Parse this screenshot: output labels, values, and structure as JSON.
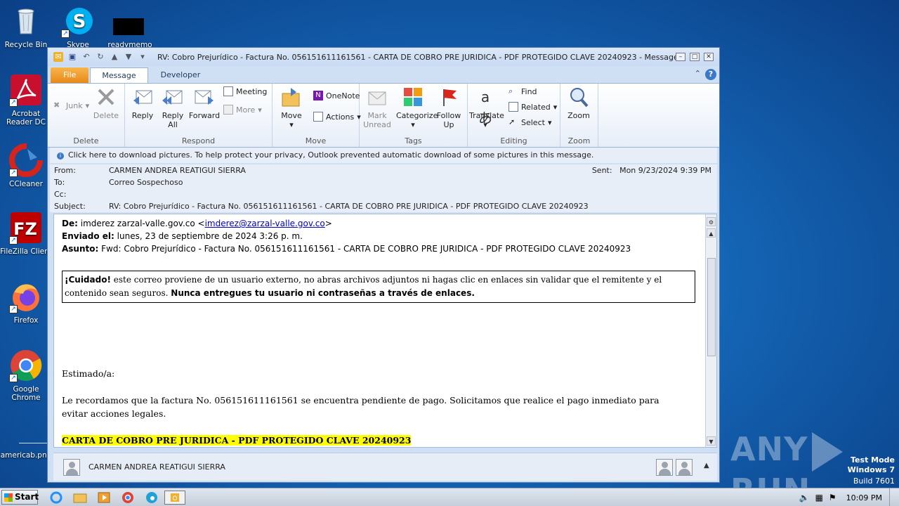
{
  "desktop": {
    "icons": [
      {
        "label": "Recycle Bin"
      },
      {
        "label": "Skype"
      },
      {
        "label": "readymemo"
      },
      {
        "label": "Acrobat Reader DC"
      },
      {
        "label": "CCleaner"
      },
      {
        "label": "FileZilla Client"
      },
      {
        "label": "Firefox"
      },
      {
        "label": "Google Chrome"
      },
      {
        "label": "americab.png"
      }
    ],
    "watermark": {
      "brand": "ANY RUN",
      "mode": "Test Mode",
      "os": "Windows 7",
      "build": "Build 7601"
    }
  },
  "window": {
    "title": "RV: Cobro Prejurídico - Factura No. 056151611161561 - CARTA DE COBRO PRE JURIDICA - PDF PROTEGIDO CLAVE 20240923  -  Message (HTM...",
    "tabs": [
      "File",
      "Message",
      "Developer"
    ],
    "ribbon": {
      "delete": {
        "label": "Delete",
        "junk": "Junk",
        "delete_btn": "Delete"
      },
      "respond": {
        "label": "Respond",
        "reply": "Reply",
        "reply_all": "Reply All",
        "forward": "Forward",
        "meeting": "Meeting",
        "more": "More"
      },
      "move": {
        "label": "Move",
        "move_btn": "Move",
        "onenote": "OneNote",
        "actions": "Actions"
      },
      "tags": {
        "label": "Tags",
        "mark_unread": "Mark Unread",
        "categorize": "Categorize",
        "follow_up": "Follow Up"
      },
      "editing": {
        "label": "Editing",
        "translate": "Translate",
        "find": "Find",
        "related": "Related",
        "select": "Select"
      },
      "zoom": {
        "label": "Zoom",
        "zoom_btn": "Zoom"
      }
    },
    "infobar": "Click here to download pictures. To help protect your privacy, Outlook prevented automatic download of some pictures in this message.",
    "header": {
      "from_label": "From:",
      "from": "CARMEN ANDREA REATIGUI SIERRA",
      "to_label": "To:",
      "to": "Correo Sospechoso",
      "cc_label": "Cc:",
      "cc": "",
      "subject_label": "Subject:",
      "subject": "RV: Cobro Prejurídico - Factura No. 056151611161561 - CARTA DE COBRO PRE JURIDICA - PDF PROTEGIDO CLAVE 20240923",
      "sent_label": "Sent:",
      "sent": "Mon 9/23/2024 9:39 PM"
    },
    "body": {
      "de_label": "De:",
      "de_name": "imderez zarzal-valle.gov.co <",
      "de_email": "imderez@zarzal-valle.gov.co",
      "de_close": ">",
      "enviado_label": "Enviado el:",
      "enviado": "lunes, 23 de septiembre de 2024 3:26 p. m.",
      "asunto_label": "Asunto:",
      "asunto": "Fwd: Cobro Prejurídico - Factura No. 056151611161561 - CARTA DE COBRO PRE JURIDICA - PDF PROTEGIDO CLAVE 20240923",
      "warning_strong": "¡Cuidado!",
      "warning_text": "este correo proviene de un usuario externo, no abras archivos adjuntos ni hagas clic en enlaces sin validar que el remitente y el contenido sean seguros.",
      "warning_bold": "Nunca entregues tu usuario ni contraseñas a través de enlaces.",
      "greeting": "Estimado/a:",
      "paragraph": "Le recordamos que la factura No. 056151611161561 se encuentra pendiente de pago. Solicitamos que realice el pago inmediato para evitar acciones legales.",
      "highlight": "CARTA DE COBRO PRE JURIDICA - PDF PROTEGIDO CLAVE 20240923"
    },
    "people_pane": {
      "name": "CARMEN ANDREA REATIGUI SIERRA"
    }
  },
  "taskbar": {
    "start": "Start",
    "time": "10:09 PM"
  }
}
